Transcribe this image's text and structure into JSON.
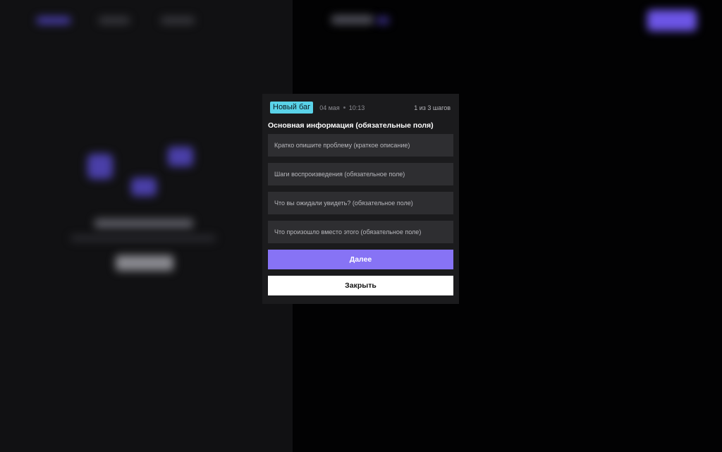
{
  "modal": {
    "badge": "Новый баг",
    "date": "04 мая",
    "time": "10:13",
    "steps": "1 из 3 шагов",
    "section_title": "Основная информация (обязательные поля)",
    "fields": [
      {
        "placeholder": "Кратко опишите проблему (краткое описание)",
        "value": ""
      },
      {
        "placeholder": "Шаги воспроизведения (обязательное поле)",
        "value": ""
      },
      {
        "placeholder": "Что вы ожидали увидеть? (обязательное поле)",
        "value": ""
      },
      {
        "placeholder": "Что произошло вместо этого (обязательное поле)",
        "value": ""
      }
    ],
    "next_label": "Далее",
    "close_label": "Закрыть"
  },
  "colors": {
    "badge_bg": "#5ad2e8",
    "primary_button": "#8773f5",
    "modal_bg": "#1b1b1d",
    "field_bg": "#2e2e31"
  }
}
